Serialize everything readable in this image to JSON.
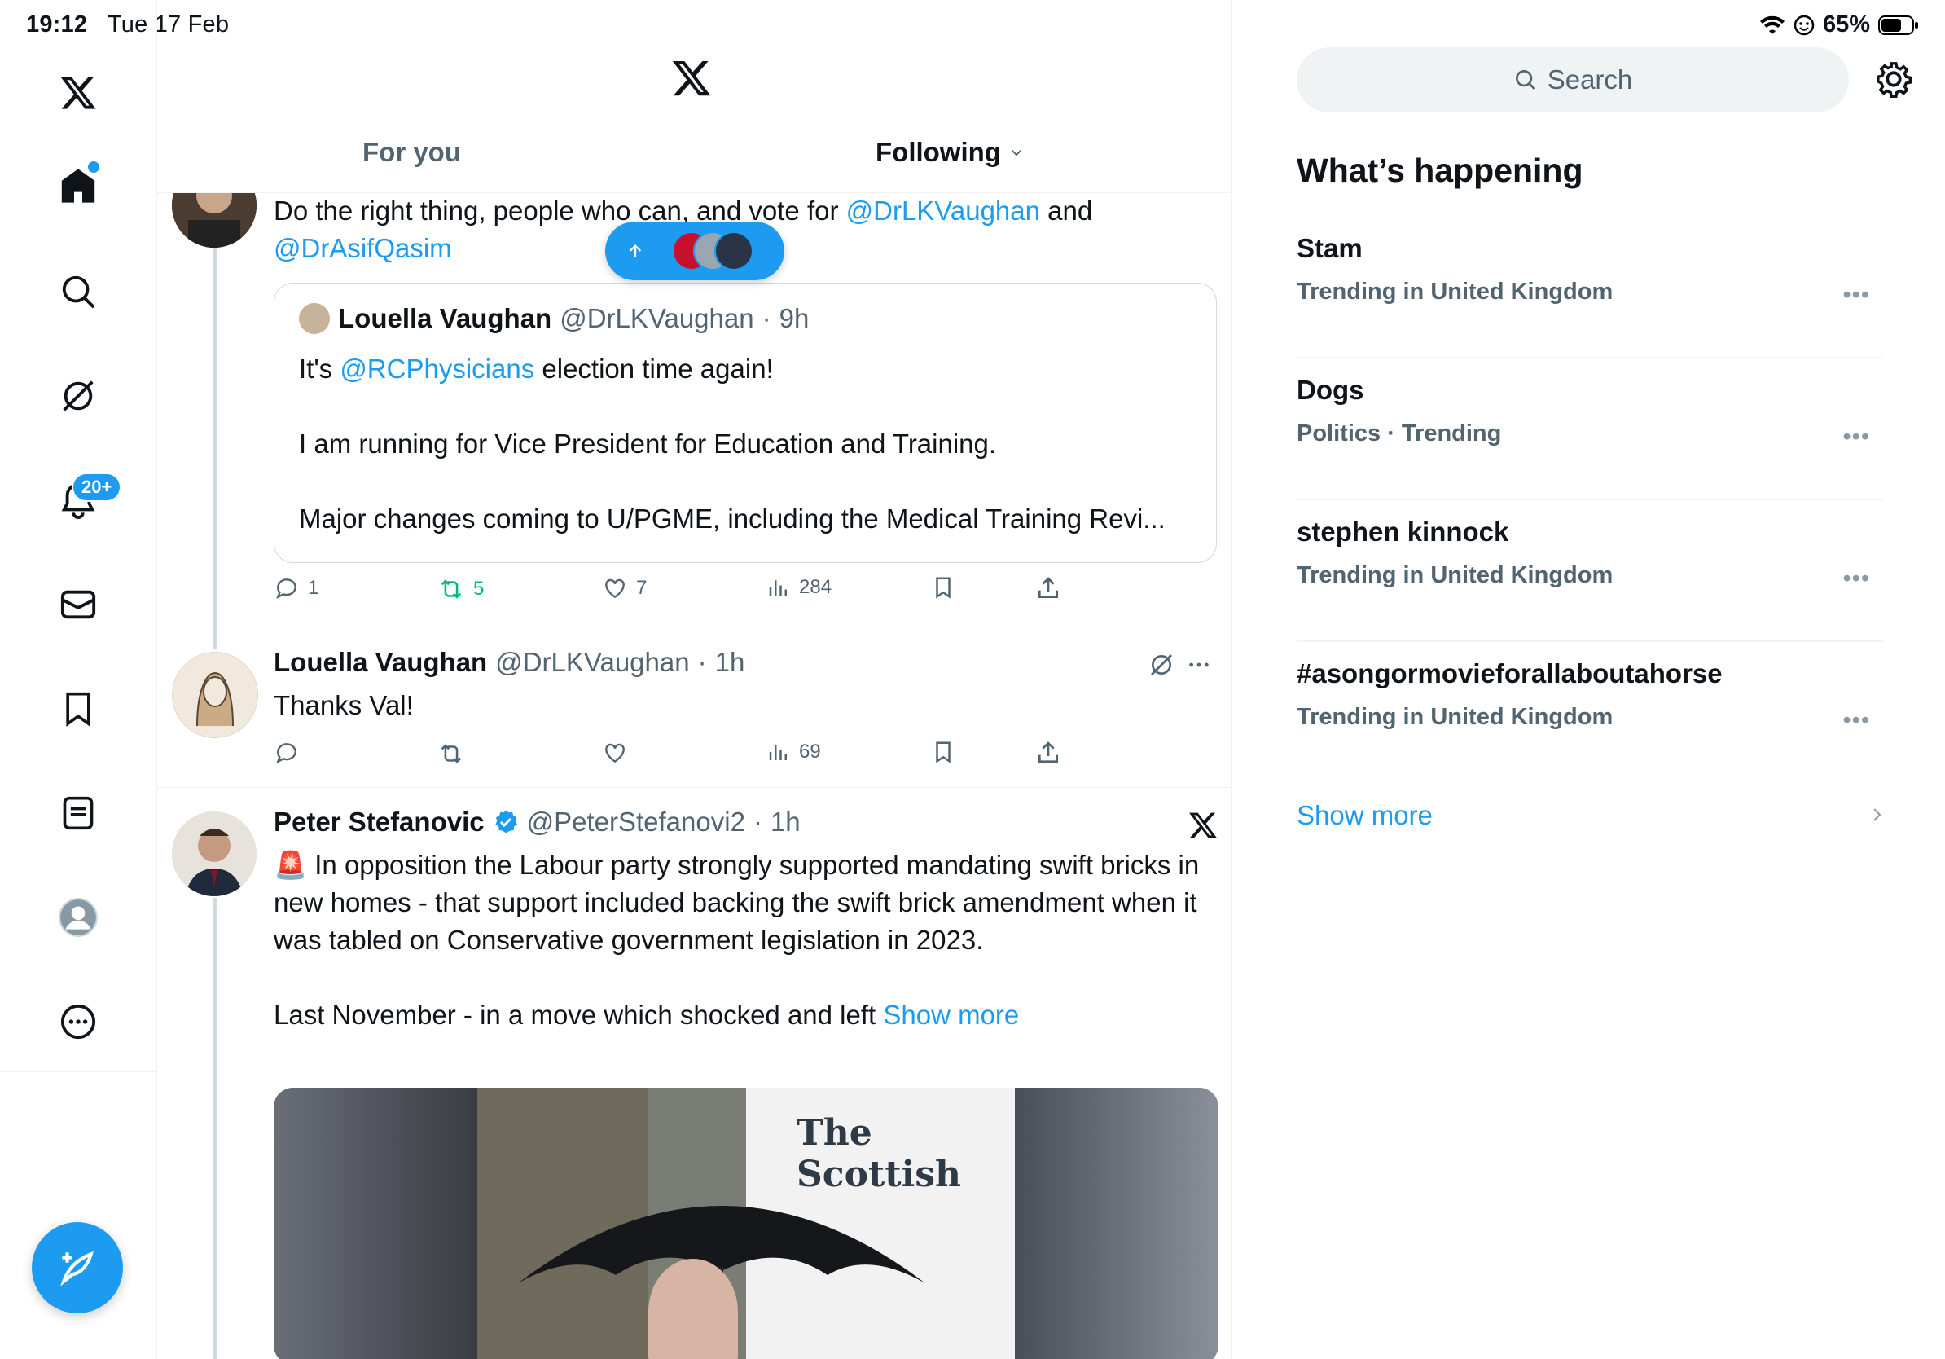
{
  "status": {
    "time": "19:12",
    "date": "Tue 17 Feb",
    "battery": "65%"
  },
  "nav": {
    "items": [
      "x-logo",
      "home",
      "search",
      "grok",
      "notifications",
      "messages",
      "bookmarks",
      "lists",
      "profile",
      "more"
    ],
    "notification_badge": "20+"
  },
  "tabs": {
    "for_you": "For you",
    "following": "Following"
  },
  "tweet1": {
    "text_prefix": "Do the right thing, people who can, and vote for ",
    "mention1": "@DrLKVaughan",
    "text_mid": " and",
    "mention2": "@DrAsifQasim",
    "quote": {
      "name": "Louella Vaughan",
      "handle": "@DrLKVaughan",
      "time": "9h",
      "line1_prefix": "It's ",
      "line1_mention": "@RCPhysicians",
      "line1_suffix": " election time again!",
      "line2": "I am running for Vice President for Education and Training.",
      "line3": "Major changes coming to U/PGME, including the Medical Training Revi..."
    },
    "replies": "1",
    "reposts": "5",
    "likes": "7",
    "views": "284"
  },
  "tweet2": {
    "name": "Louella Vaughan",
    "handle": "@DrLKVaughan",
    "time": "1h",
    "text": "Thanks Val!",
    "views": "69"
  },
  "tweet3": {
    "name": "Peter Stefanovic",
    "handle": "@PeterStefanovi2",
    "time": "1h",
    "emoji": "🚨",
    "text": " In opposition the Labour party strongly supported mandating swift bricks in new homes - that support included backing the swift brick amendment when it was tabled on Conservative government legislation in 2023.",
    "text2": "Last November - in a move which shocked and left ",
    "show_more": "Show more",
    "media_caption": "The Scottish"
  },
  "right": {
    "search_placeholder": "Search",
    "title": "What’s happening",
    "trends": [
      {
        "name": "Stam",
        "meta": "Trending in United Kingdom"
      },
      {
        "name": "Dogs",
        "meta": "Politics · Trending"
      },
      {
        "name": "stephen kinnock",
        "meta": "Trending in United Kingdom"
      },
      {
        "name": "#asongormovieforallaboutahorse",
        "meta": "Trending in United Kingdom"
      }
    ],
    "show_more": "Show more"
  },
  "colors": {
    "accent": "#1d9bf0",
    "repost_active": "#00ba7c",
    "text": "#0f1419",
    "muted": "#536471"
  }
}
